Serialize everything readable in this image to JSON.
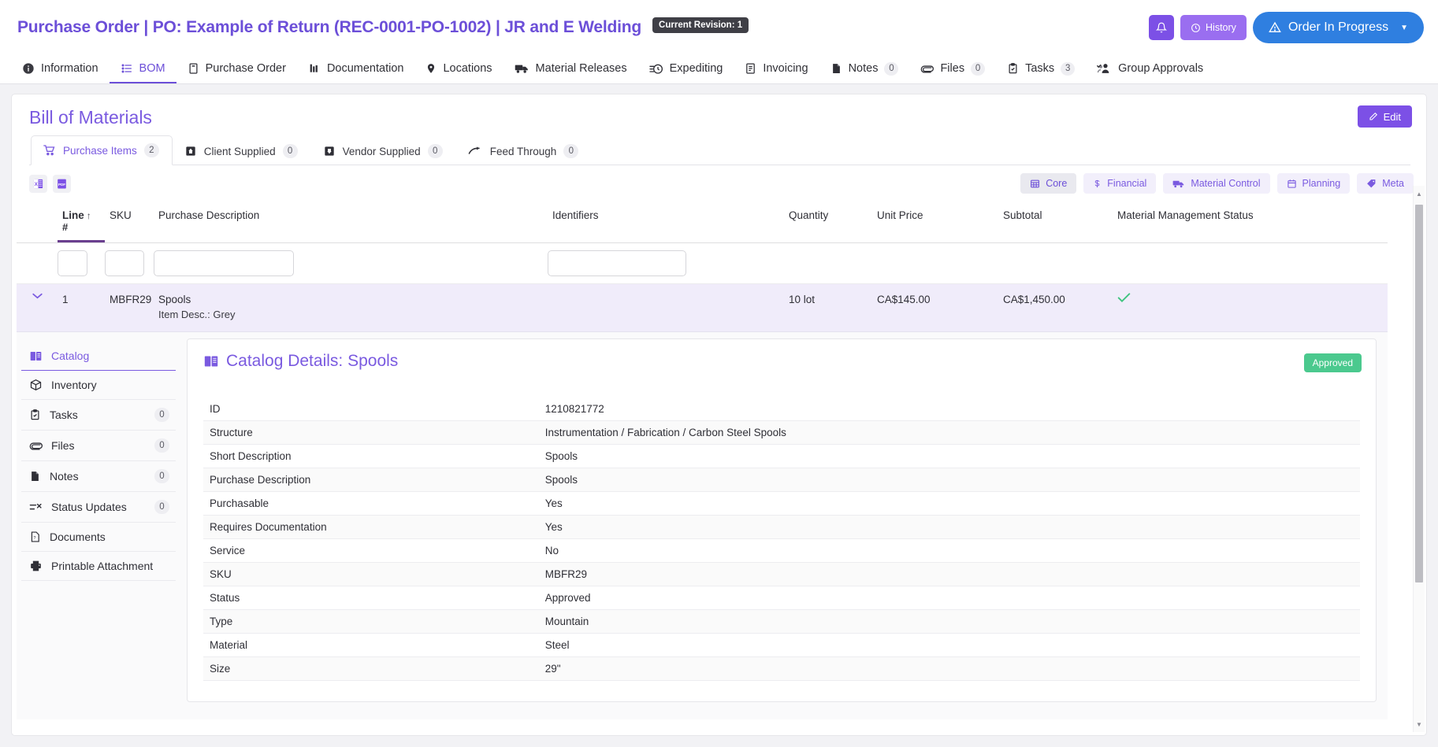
{
  "header": {
    "title": "Purchase Order | PO: Example of Return (REC-0001-PO-1002) | JR and E Welding",
    "revision_badge": "Current Revision: 1",
    "history_label": "History",
    "status_label": "Order In Progress",
    "bell_icon": "bell-icon",
    "history_icon": "clock-history-icon",
    "status_icon": "alert-triangle-icon",
    "caret_icon": "caret-down-icon",
    "accent_purple": "#6c4fd8",
    "status_blue": "#2f7fe0"
  },
  "nav_tabs": [
    {
      "label": "Information",
      "icon": "info-circle-icon",
      "count": null,
      "active": false
    },
    {
      "label": "BOM",
      "icon": "list-icon",
      "count": null,
      "active": true
    },
    {
      "label": "Purchase Order",
      "icon": "document-icon",
      "count": null,
      "active": false
    },
    {
      "label": "Documentation",
      "icon": "chart-bars-icon",
      "count": null,
      "active": false
    },
    {
      "label": "Locations",
      "icon": "map-pin-icon",
      "count": null,
      "active": false
    },
    {
      "label": "Material Releases",
      "icon": "truck-icon",
      "count": null,
      "active": false
    },
    {
      "label": "Expediting",
      "icon": "stopwatch-icon",
      "count": null,
      "active": false
    },
    {
      "label": "Invoicing",
      "icon": "invoice-icon",
      "count": null,
      "active": false
    },
    {
      "label": "Notes",
      "icon": "note-icon",
      "count": "0",
      "active": false
    },
    {
      "label": "Files",
      "icon": "paperclip-icon",
      "count": "0",
      "active": false
    },
    {
      "label": "Tasks",
      "icon": "clipboard-check-icon",
      "count": "3",
      "active": false
    },
    {
      "label": "Group Approvals",
      "icon": "users-check-icon",
      "count": null,
      "active": false
    }
  ],
  "page": {
    "title": "Bill of Materials",
    "edit_label": "Edit",
    "edit_icon": "pencil-icon"
  },
  "sub_tabs": [
    {
      "label": "Purchase Items",
      "count": "2",
      "icon": "shopping-cart-icon",
      "active": true
    },
    {
      "label": "Client Supplied",
      "count": "0",
      "icon": "box-up-icon",
      "active": false
    },
    {
      "label": "Vendor Supplied",
      "count": "0",
      "icon": "box-down-icon",
      "active": false
    },
    {
      "label": "Feed Through",
      "count": "0",
      "icon": "arrow-curve-icon",
      "active": false
    }
  ],
  "export_buttons": [
    {
      "label": "XLS",
      "name": "export-excel-button"
    },
    {
      "label": "PDF",
      "name": "export-pdf-button"
    }
  ],
  "view_chips": [
    {
      "label": "Core",
      "icon": "grid-icon",
      "selected": true
    },
    {
      "label": "Financial",
      "icon": "dollar-icon",
      "selected": false
    },
    {
      "label": "Material Control",
      "icon": "truck-icon",
      "selected": false
    },
    {
      "label": "Planning",
      "icon": "calendar-icon",
      "selected": false
    },
    {
      "label": "Meta",
      "icon": "tag-icon",
      "selected": false
    }
  ],
  "grid": {
    "columns": [
      {
        "label": "Line",
        "sub": "#",
        "sorted": true,
        "sort_dir": "asc"
      },
      {
        "label": "SKU",
        "sub": "",
        "sorted": false
      },
      {
        "label": "Purchase Description",
        "sub": "",
        "sorted": false
      },
      {
        "label": "Identifiers",
        "sub": "",
        "sorted": false
      },
      {
        "label": "Quantity",
        "sub": "",
        "sorted": false
      },
      {
        "label": "Unit Price",
        "sub": "",
        "sorted": false
      },
      {
        "label": "Subtotal",
        "sub": "",
        "sorted": false
      },
      {
        "label": "Material Management Status",
        "sub": "",
        "sorted": false
      }
    ],
    "filters": {
      "line": "",
      "sku": "",
      "description": "",
      "identifiers": ""
    },
    "rows": [
      {
        "line": "1",
        "sku": "MBFR29",
        "description": "Spools",
        "description_sub": "Item Desc.: Grey",
        "identifiers": "",
        "quantity": "10 lot",
        "unit_price": "CA$145.00",
        "subtotal": "CA$1,450.00",
        "status_icon": "check-icon",
        "expanded": true
      }
    ]
  },
  "detail_nav": [
    {
      "label": "Catalog",
      "icon": "book-icon",
      "count": null,
      "active": true
    },
    {
      "label": "Inventory",
      "icon": "box-icon",
      "count": null,
      "active": false
    },
    {
      "label": "Tasks",
      "icon": "clipboard-check-icon",
      "count": "0",
      "active": false
    },
    {
      "label": "Files",
      "icon": "paperclip-icon",
      "count": "0",
      "active": false
    },
    {
      "label": "Notes",
      "icon": "note-icon",
      "count": "0",
      "active": false
    },
    {
      "label": "Status Updates",
      "icon": "status-updates-icon",
      "count": "0",
      "active": false
    },
    {
      "label": "Documents",
      "icon": "document-question-icon",
      "count": null,
      "active": false
    },
    {
      "label": "Printable Attachment",
      "icon": "printer-icon",
      "count": null,
      "active": false
    }
  ],
  "detail_panel": {
    "title": "Catalog Details: Spools",
    "title_icon": "book-icon",
    "status_badge": "Approved",
    "status_badge_color": "#4bc98e",
    "fields": [
      {
        "key": "ID",
        "value": "1210821772"
      },
      {
        "key": "Structure",
        "value": "Instrumentation / Fabrication / Carbon Steel Spools"
      },
      {
        "key": "Short Description",
        "value": "Spools"
      },
      {
        "key": "Purchase Description",
        "value": "Spools"
      },
      {
        "key": "Purchasable",
        "value": "Yes"
      },
      {
        "key": "Requires Documentation",
        "value": "Yes"
      },
      {
        "key": "Service",
        "value": "No"
      },
      {
        "key": "SKU",
        "value": "MBFR29"
      },
      {
        "key": "Status",
        "value": "Approved"
      },
      {
        "key": "Type",
        "value": "Mountain"
      },
      {
        "key": "Material",
        "value": "Steel"
      },
      {
        "key": "Size",
        "value": "29\""
      }
    ]
  }
}
